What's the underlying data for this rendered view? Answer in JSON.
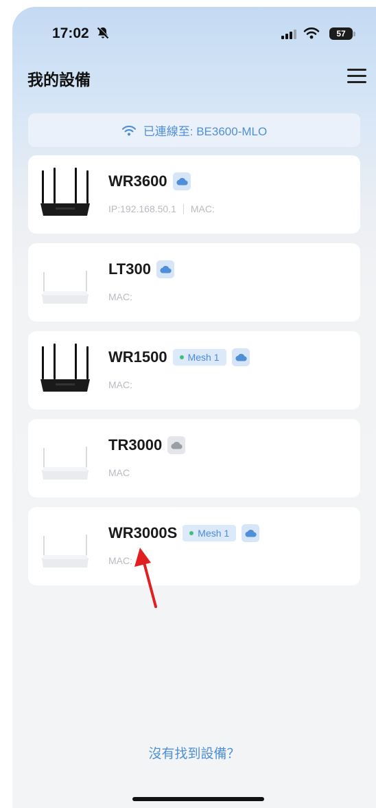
{
  "status_bar": {
    "time": "17:02",
    "battery": "57"
  },
  "header": {
    "title": "我的設備"
  },
  "banner": {
    "text": "已連線至: BE3600-MLO"
  },
  "devices": [
    {
      "name": "WR3600",
      "ip": "IP:192.168.50.1",
      "mac": "MAC:",
      "cloud": "blue",
      "router_color": "black"
    },
    {
      "name": "LT300",
      "mac": "MAC:",
      "cloud": "blue",
      "router_color": "white"
    },
    {
      "name": "WR1500",
      "mesh": "Mesh 1",
      "mac": "MAC:",
      "cloud": "blue",
      "router_color": "black"
    },
    {
      "name": "TR3000",
      "mac": "MAC",
      "cloud": "gray",
      "router_color": "white"
    },
    {
      "name": "WR3000S",
      "mesh": "Mesh 1",
      "mac": "MAC:",
      "cloud": "blue",
      "router_color": "white"
    }
  ],
  "footer": {
    "no_device_link": "沒有找到設備？"
  },
  "colors": {
    "accent": "#4f8fd8",
    "annotation_arrow": "#e02020"
  }
}
